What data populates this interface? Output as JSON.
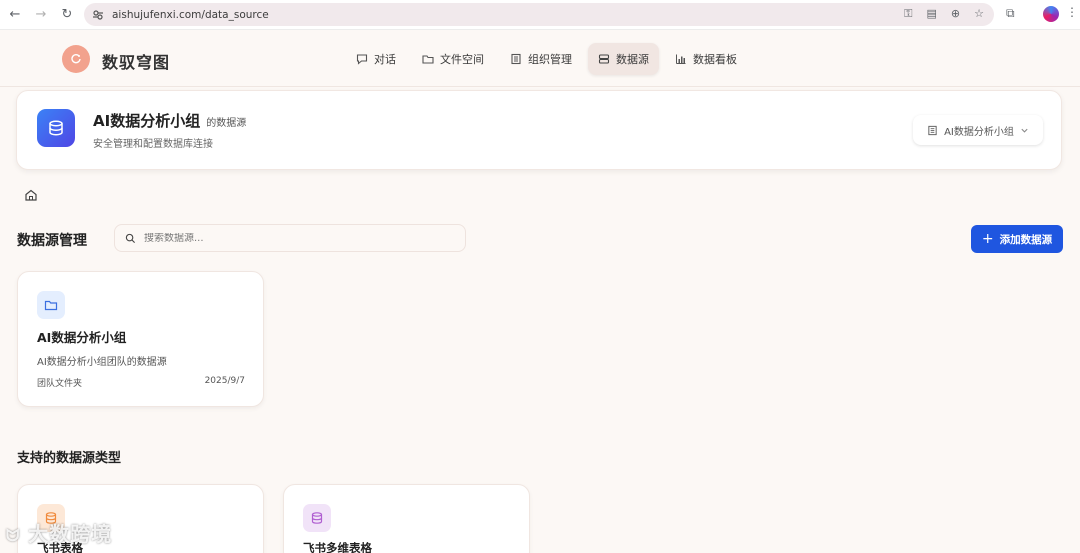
{
  "browser": {
    "url": "aishujufenxi.com/data_source",
    "back_icon": "arrow-left-icon",
    "forward_icon": "arrow-right-icon",
    "reload_icon": "reload-icon"
  },
  "app": {
    "title": "数驭穹图"
  },
  "nav": {
    "items": [
      {
        "label": "对话",
        "icon": "chat-icon"
      },
      {
        "label": "文件空间",
        "icon": "folder-icon"
      },
      {
        "label": "组织管理",
        "icon": "building-icon"
      },
      {
        "label": "数据源",
        "icon": "database-icon",
        "active": true
      },
      {
        "label": "数据看板",
        "icon": "bar-chart-icon"
      }
    ]
  },
  "team": {
    "name": "AI数据分析小组",
    "suffix": "的数据源",
    "subtitle": "安全管理和配置数据库连接",
    "selector_label": "AI数据分析小组"
  },
  "datasource": {
    "section_title": "数据源管理",
    "search_placeholder": "搜索数据源...",
    "add_button": "添加数据源",
    "cards": [
      {
        "title": "AI数据分析小组",
        "description": "AI数据分析小组团队的数据源",
        "type": "团队文件夹",
        "date": "2025/9/7"
      }
    ]
  },
  "supported": {
    "title": "支持的数据源类型",
    "types": [
      {
        "name": "飞书表格",
        "color": "#fde8d7",
        "icon_color": "#f08a3c"
      },
      {
        "name": "飞书多维表格",
        "color": "#f1e3f8",
        "icon_color": "#b05fd1"
      }
    ]
  },
  "watermark": "大数跨境",
  "colors": {
    "primary": "#1f56e0",
    "logo": "#f2a28d",
    "badge_gradient_start": "#3b82f6",
    "badge_gradient_end": "#4f46e5"
  }
}
